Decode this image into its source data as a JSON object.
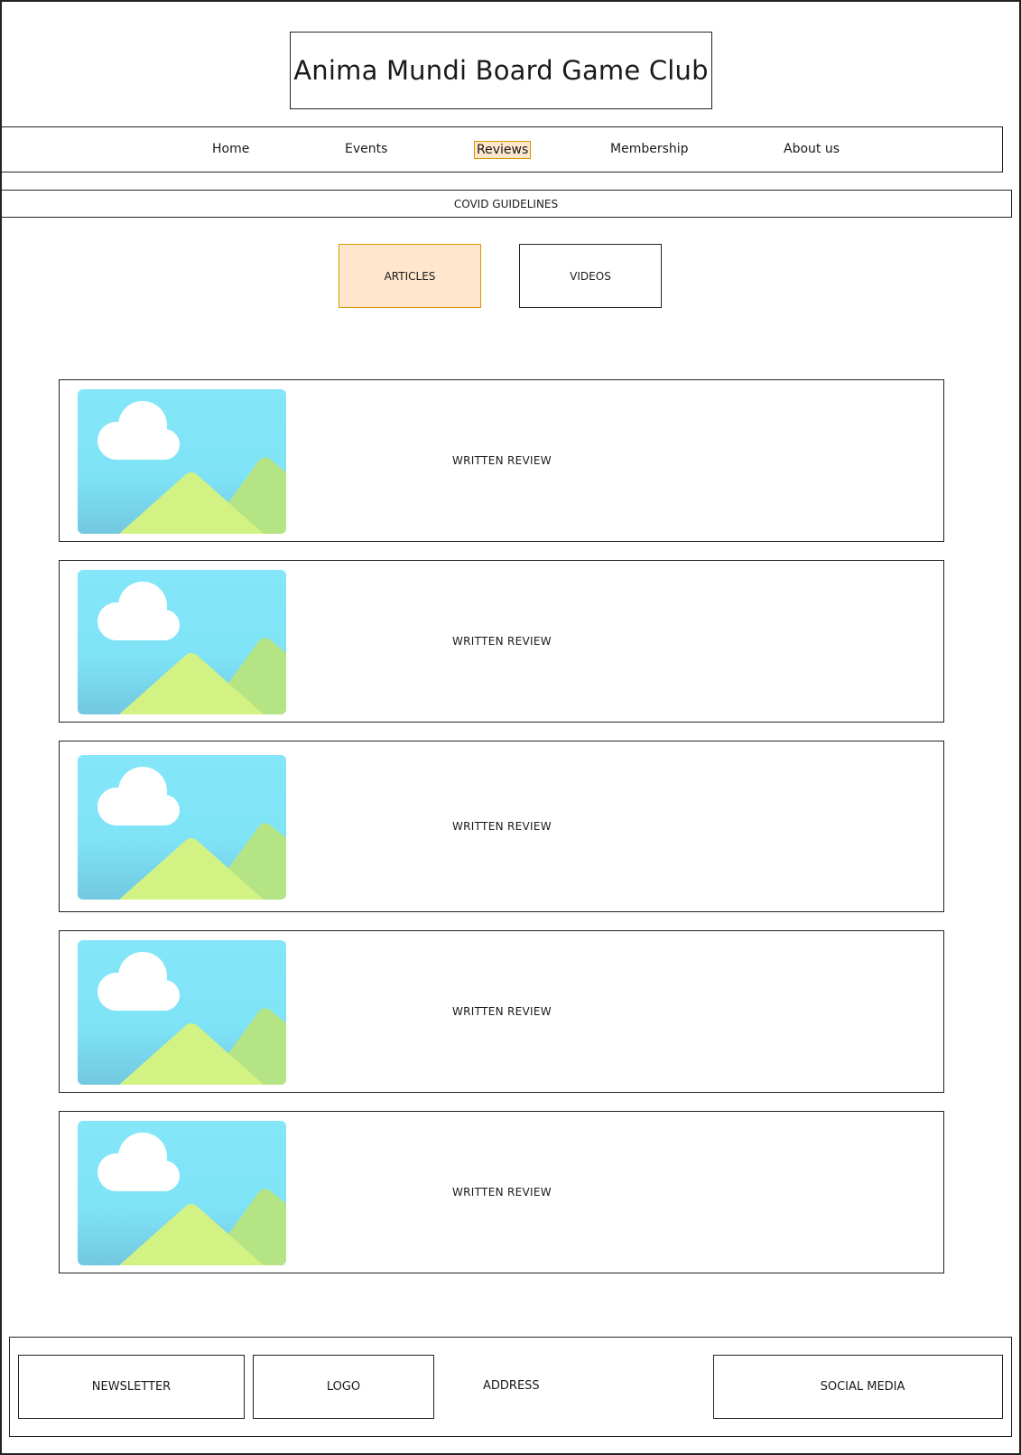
{
  "header": {
    "title": "Anima Mundi Board Game Club"
  },
  "nav": {
    "items": [
      {
        "label": "Home",
        "active": false
      },
      {
        "label": "Events",
        "active": false
      },
      {
        "label": "Reviews",
        "active": true
      },
      {
        "label": "Membership",
        "active": false
      },
      {
        "label": "About us",
        "active": false
      }
    ]
  },
  "banner": {
    "covid_label": "COVID GUIDELINES"
  },
  "tabs": [
    {
      "label": "ARTICLES",
      "selected": true
    },
    {
      "label": "VIDEOS",
      "selected": false
    }
  ],
  "reviews": [
    {
      "label": "WRITTEN REVIEW",
      "image_icon": "landscape-image-icon"
    },
    {
      "label": "WRITTEN REVIEW",
      "image_icon": "landscape-image-icon"
    },
    {
      "label": "WRITTEN REVIEW",
      "image_icon": "landscape-image-icon"
    },
    {
      "label": "WRITTEN REVIEW",
      "image_icon": "landscape-image-icon"
    },
    {
      "label": "WRITTEN REVIEW",
      "image_icon": "landscape-image-icon"
    }
  ],
  "footer": {
    "newsletter": "NEWSLETTER",
    "logo": "LOGO",
    "address": "ADDRESS",
    "social_media": "SOCIAL MEDIA"
  },
  "colors": {
    "highlight_fill": "#ffe6cc",
    "highlight_border": "#d79b00",
    "sky": "#7fe3f7",
    "hill_back": "#b5e484",
    "hill_front": "#d2f283"
  }
}
